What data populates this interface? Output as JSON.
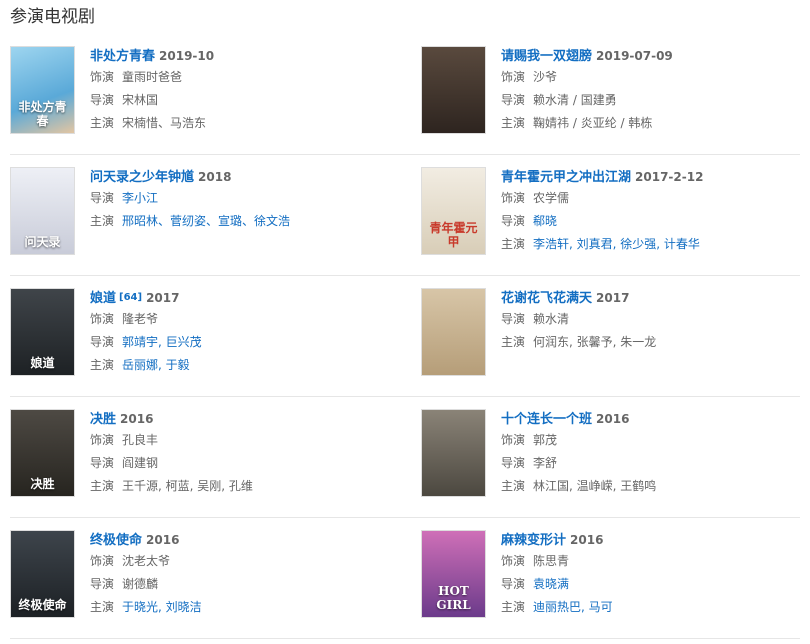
{
  "section_title": "参演电视剧",
  "dramas": [
    {
      "title": "非处方青春",
      "year": "2019-10",
      "ref": "",
      "poster_text": "非处方青春",
      "rows": [
        {
          "label": "饰演",
          "value": "童雨时爸爸",
          "link": false
        },
        {
          "label": "导演",
          "value": "宋林国",
          "link": false
        },
        {
          "label": "主演",
          "value": "宋楠惜、马浩东",
          "link": false
        }
      ]
    },
    {
      "title": "请赐我一双翅膀",
      "year": "2019-07-09",
      "ref": "",
      "poster_text": "",
      "rows": [
        {
          "label": "饰演",
          "value": "沙爷",
          "link": false
        },
        {
          "label": "导演",
          "value": "赖水清 / 国建勇",
          "link": false
        },
        {
          "label": "主演",
          "value": "鞠婧祎 / 炎亚纶 / 韩栋",
          "link": false
        }
      ]
    },
    {
      "title": "问天录之少年钟馗",
      "year": "2018",
      "ref": "",
      "poster_text": "问天录",
      "rows": [
        {
          "label": "导演",
          "value": "李小江",
          "link": true
        },
        {
          "label": "主演",
          "value": "邢昭林、菅纫姿、宣璐、徐文浩",
          "link": true
        }
      ]
    },
    {
      "title": "青年霍元甲之冲出江湖",
      "year": "2017-2-12",
      "ref": "",
      "poster_text": "青年霍元甲",
      "rows": [
        {
          "label": "饰演",
          "value": "农学儒",
          "link": false
        },
        {
          "label": "导演",
          "value": "郗晓",
          "link": true
        },
        {
          "label": "主演",
          "value": "李浩轩, 刘真君, 徐少强, 计春华",
          "link": true
        }
      ]
    },
    {
      "title": "娘道",
      "year": "2017",
      "ref": "[64]",
      "poster_text": "娘道",
      "rows": [
        {
          "label": "饰演",
          "value": "隆老爷",
          "link": false
        },
        {
          "label": "导演",
          "value": "郭靖宇, 巨兴茂",
          "link": true
        },
        {
          "label": "主演",
          "value": "岳丽娜, 于毅",
          "link": true
        }
      ]
    },
    {
      "title": "花谢花飞花满天",
      "year": "2017",
      "ref": "",
      "poster_text": "",
      "rows": [
        {
          "label": "导演",
          "value": "赖水清",
          "link": false
        },
        {
          "label": "主演",
          "value": "何润东, 张馨予, 朱一龙",
          "link": false
        }
      ]
    },
    {
      "title": "决胜",
      "year": "2016",
      "ref": "",
      "poster_text": "决胜",
      "rows": [
        {
          "label": "饰演",
          "value": "孔良丰",
          "link": false
        },
        {
          "label": "导演",
          "value": "阎建钢",
          "link": false
        },
        {
          "label": "主演",
          "value": "王千源, 柯蓝, 吴刚, 孔维",
          "link": false
        }
      ]
    },
    {
      "title": "十个连长一个班",
      "year": "2016",
      "ref": "",
      "poster_text": "",
      "rows": [
        {
          "label": "饰演",
          "value": "郭茂",
          "link": false
        },
        {
          "label": "导演",
          "value": "李舒",
          "link": false
        },
        {
          "label": "主演",
          "value": "林江国, 温峥嵘, 王鹤鸣",
          "link": false
        }
      ]
    },
    {
      "title": "终极使命",
      "year": "2016",
      "ref": "",
      "poster_text": "终极使命",
      "rows": [
        {
          "label": "饰演",
          "value": "沈老太爷",
          "link": false
        },
        {
          "label": "导演",
          "value": "谢德麟",
          "link": false
        },
        {
          "label": "主演",
          "value": "于晓光, 刘晓洁",
          "link": true
        }
      ]
    },
    {
      "title": "麻辣变形计",
      "year": "2016",
      "ref": "",
      "poster_text": "HOT GIRL",
      "rows": [
        {
          "label": "饰演",
          "value": "陈思青",
          "link": false
        },
        {
          "label": "导演",
          "value": "袁晓满",
          "link": true
        },
        {
          "label": "主演",
          "value": "迪丽热巴, 马可",
          "link": true
        }
      ]
    }
  ],
  "poster_colors": [
    "#6db7e0",
    "#4a3a30",
    "#d9dbe6",
    "#e8e2d6",
    "#2b2f33",
    "#c9b79a",
    "#3b3a36",
    "#6e6a60",
    "#2e3338",
    "#b25aa0"
  ]
}
